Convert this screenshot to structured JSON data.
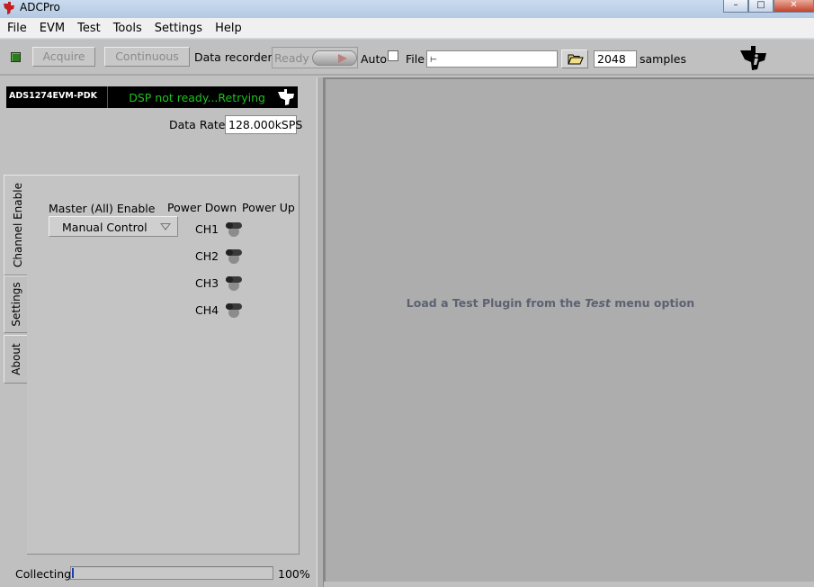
{
  "window": {
    "title": "ADCPro"
  },
  "menu": [
    "File",
    "EVM",
    "Test",
    "Tools",
    "Settings",
    "Help"
  ],
  "toolbar": {
    "acquire_label": "Acquire",
    "continuous_label": "Continuous",
    "recorder_label": "Data recorder",
    "ready_label": "Ready",
    "auto_label": "Auto",
    "file_label": "File",
    "file_path": "",
    "samples_value": "2048",
    "samples_label": "samples"
  },
  "device": {
    "name": "ADS1274EVM-PDK",
    "status": "DSP not ready...Retrying",
    "status_color": "#1ec21e"
  },
  "data_rate": {
    "label": "Data Rate",
    "value": "128.000kSPS"
  },
  "tabs": [
    {
      "label": "Channel Enable",
      "active": true
    },
    {
      "label": "Settings",
      "active": false
    },
    {
      "label": "About",
      "active": false
    }
  ],
  "channel_enable": {
    "master_label": "Master (All) Enable",
    "master_value": "Manual Control",
    "power_down_label": "Power Down",
    "power_up_label": "Power Up",
    "channels": [
      "CH1",
      "CH2",
      "CH3",
      "CH4"
    ]
  },
  "collecting": {
    "label": "Collecting",
    "percent_label": "100%",
    "progress": 0.01
  },
  "plugin_area": {
    "message_prefix": "Load a Test Plugin from the",
    "message_emph": "Test",
    "message_suffix": "menu option"
  },
  "colors": {
    "accent": "#1a3fb8",
    "panel": "#c0c0c0"
  },
  "icons": {
    "app": "ti-logo-icon",
    "folder": "folder-open-icon"
  }
}
